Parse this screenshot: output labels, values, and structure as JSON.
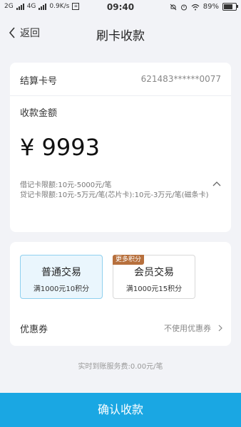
{
  "status_bar": {
    "network1": "2G",
    "network2": "4G",
    "speed": "0.9K/s",
    "time": "09:40",
    "battery": "89%",
    "battery_level": 0.89
  },
  "nav": {
    "back_label": "返回",
    "title": "刷卡收款"
  },
  "settlement": {
    "label": "结算卡号",
    "card_number": "621483******0077"
  },
  "amount": {
    "label": "收款金额",
    "value": "¥ 9993"
  },
  "limits": {
    "debit": "借记卡限额:10元-5000元/笔",
    "credit": "贷记卡限额:10元-5万元/笔(芯片卡):10元-3万元/笔(磁条卡)"
  },
  "transaction_types": [
    {
      "title": "普通交易",
      "subtitle": "满1000元10积分",
      "selected": true
    },
    {
      "title": "会员交易",
      "subtitle": "满1000元15积分",
      "badge": "更多积分",
      "selected": false
    }
  ],
  "coupon": {
    "label": "优惠券",
    "value": "不使用优惠券"
  },
  "fee_text": "实时到账服务费:0.00元/笔",
  "confirm_label": "确认收款",
  "colors": {
    "primary": "#1aa7e3",
    "selected_bg": "#eaf6fd",
    "selected_border": "#8fd0ef",
    "badge": "#b7703d",
    "page_bg": "#f2f3f7"
  },
  "icons": [
    "signal-icon",
    "wifi-icon",
    "alarm-icon",
    "mute-icon",
    "battery-icon",
    "back-chevron-icon",
    "chevron-up-icon",
    "chevron-right-icon"
  ]
}
